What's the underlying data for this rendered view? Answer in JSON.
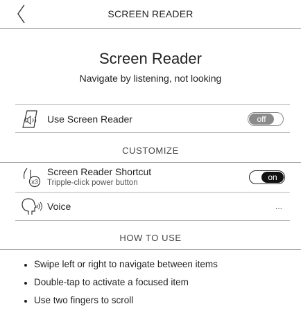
{
  "header": {
    "title": "SCREEN READER"
  },
  "hero": {
    "title": "Screen Reader",
    "subtitle": "Navigate by listening, not looking"
  },
  "use_screen_reader": {
    "label": "Use Screen Reader",
    "icon": "speaker-icon",
    "toggle_state": "off"
  },
  "customize": {
    "header": "CUSTOMIZE",
    "shortcut": {
      "label": "Screen Reader Shortcut",
      "sublabel": "Tripple-click power button",
      "icon": "triple-click-icon",
      "icon_badge": "x3",
      "toggle_state": "on"
    },
    "voice": {
      "label": "Voice",
      "icon": "speaking-head-icon",
      "more": "..."
    }
  },
  "how_to_use": {
    "header": "HOW TO USE",
    "items": [
      "Swipe left or right to navigate between items",
      "Double-tap to activate a focused item",
      "Use two fingers to scroll"
    ]
  }
}
